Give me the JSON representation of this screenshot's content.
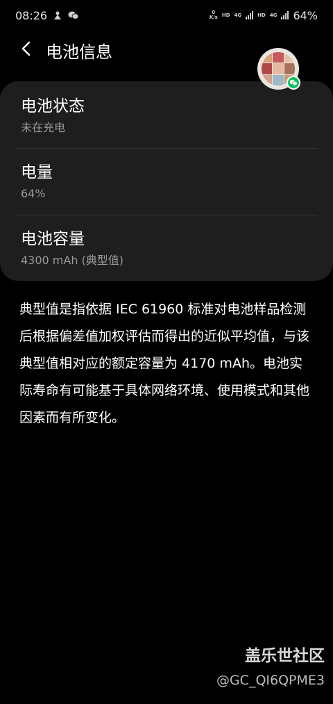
{
  "status_bar": {
    "time": "08:26",
    "speed_value": "0",
    "speed_unit": "K/s",
    "hd1": "HD",
    "net1": "4G",
    "hd2": "HD",
    "net2": "4G",
    "battery_percent": "64%"
  },
  "header": {
    "title": "电池信息"
  },
  "card": {
    "items": [
      {
        "title": "电池状态",
        "subtitle": "未在充电"
      },
      {
        "title": "电量",
        "subtitle": "64%"
      },
      {
        "title": "电池容量",
        "subtitle": "4300 mAh (典型值)"
      }
    ]
  },
  "description": "典型值是指依据 IEC 61960 标准对电池样品检测后根据偏差值加权评估而得出的近似平均值，与该典型值相对应的额定容量为 4170 mAh。电池实际寿命有可能基于具体网络环境、使用模式和其他因素而有所变化。",
  "watermark": {
    "brand": "盖乐世社区",
    "handle": "@GC_QI6QPME3"
  },
  "colors": {
    "background": "#000000",
    "card": "#1e1e1e",
    "secondary_text": "#9a9a9a",
    "wechat_green": "#07c160"
  },
  "icons": {
    "back": "chevron-left-icon",
    "status_app1": "app-notification-icon",
    "status_app2": "wechat-icon",
    "floating": "wechat-floating-avatar"
  }
}
